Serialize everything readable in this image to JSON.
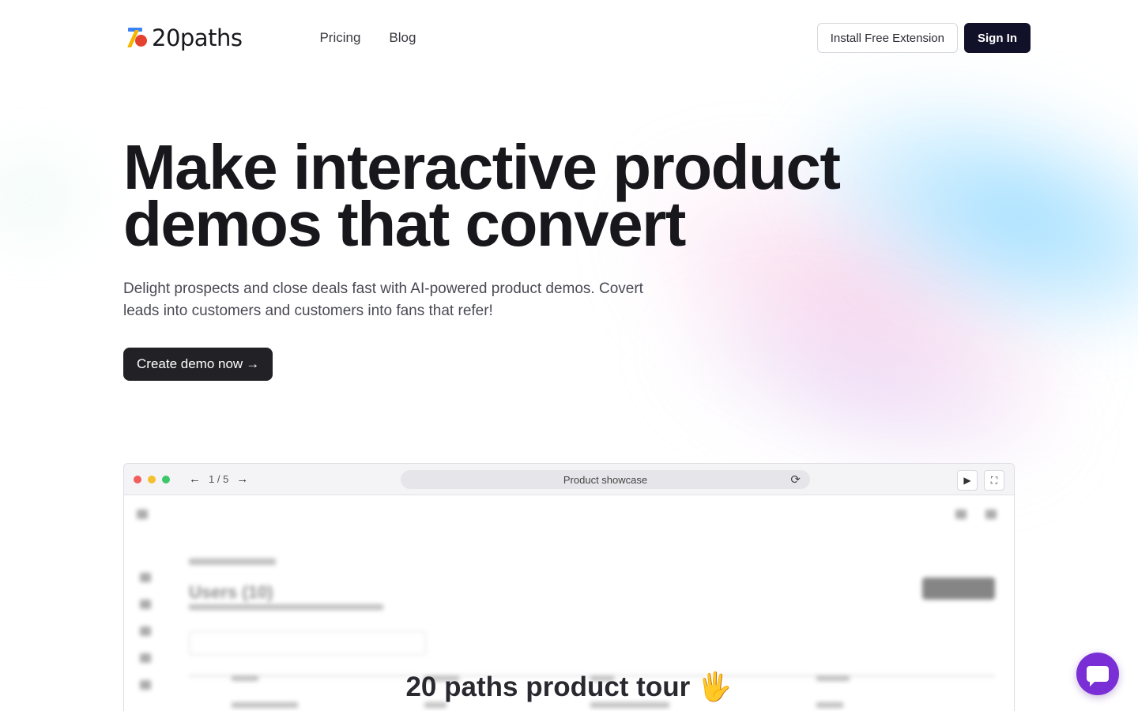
{
  "header": {
    "logo_text": "20paths",
    "nav": [
      {
        "label": "Pricing"
      },
      {
        "label": "Blog"
      }
    ],
    "install_label": "Install Free Extension",
    "signin_label": "Sign In"
  },
  "hero": {
    "title_line1": "Make interactive product",
    "title_line2": "demos that convert",
    "subtitle_line1": "Delight prospects and close deals fast with AI-powered product demos. Covert",
    "subtitle_line2": "leads into customers and customers into fans that refer!",
    "cta_label": "Create demo now",
    "cta_arrow": "→"
  },
  "demo": {
    "page_counter": "1 / 5",
    "address_text": "Product showcase",
    "blurred_title": "Users (10)",
    "tour_title": "20 paths product tour 🖐"
  },
  "colors": {
    "brand_dark": "#12112a",
    "chat_accent": "#7a2fd6"
  },
  "icons": [
    "logo-icon",
    "back-arrow-icon",
    "forward-arrow-icon",
    "reload-icon",
    "play-icon",
    "fullscreen-icon",
    "chat-icon"
  ]
}
